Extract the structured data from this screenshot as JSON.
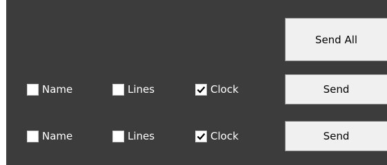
{
  "panel": {
    "background": "#3c3c3c",
    "send_all_label": "Send All"
  },
  "rows": [
    {
      "name": {
        "label": "Name",
        "checked": false
      },
      "lines": {
        "label": "Lines",
        "checked": false
      },
      "clock": {
        "label": "Clock",
        "checked": true
      },
      "send_label": "Send"
    },
    {
      "name": {
        "label": "Name",
        "checked": false
      },
      "lines": {
        "label": "Lines",
        "checked": false
      },
      "clock": {
        "label": "Clock",
        "checked": true
      },
      "send_label": "Send"
    }
  ]
}
